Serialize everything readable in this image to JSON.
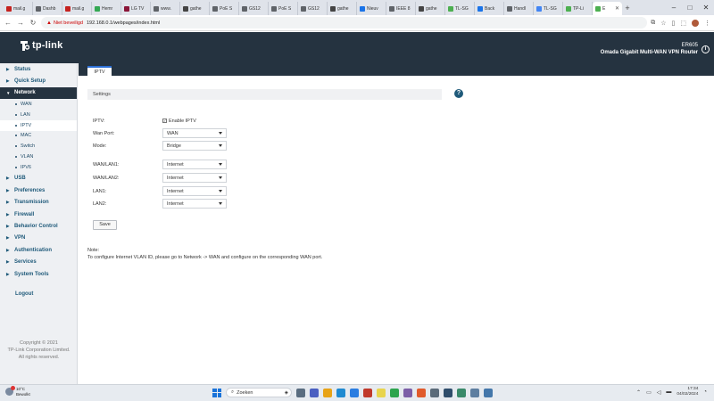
{
  "browser": {
    "tabs": [
      {
        "label": "mail.g",
        "color": "#c5221f"
      },
      {
        "label": "Dashb",
        "color": "#5f6368"
      },
      {
        "label": "mail.g",
        "color": "#c5221f"
      },
      {
        "label": "Hemr",
        "color": "#34a853"
      },
      {
        "label": "LG TV",
        "color": "#8a1538"
      },
      {
        "label": "www.",
        "color": "#5f6368"
      },
      {
        "label": "gathe",
        "color": "#444"
      },
      {
        "label": "PoE S",
        "color": "#5f6368"
      },
      {
        "label": "GS12",
        "color": "#5f6368"
      },
      {
        "label": "PoE S",
        "color": "#5f6368"
      },
      {
        "label": "GS12",
        "color": "#5f6368"
      },
      {
        "label": "gathe",
        "color": "#444"
      },
      {
        "label": "Nieuv",
        "color": "#1a73e8"
      },
      {
        "label": "IEEE 8",
        "color": "#5f6368"
      },
      {
        "label": "gathe",
        "color": "#444"
      },
      {
        "label": "TL-SG",
        "color": "#4caf50"
      },
      {
        "label": "Back",
        "color": "#1a73e8"
      },
      {
        "label": "Handl",
        "color": "#5f6368"
      },
      {
        "label": "TL-SG",
        "color": "#4285f4"
      },
      {
        "label": "TP-Li",
        "color": "#4caf50"
      },
      {
        "label": "E",
        "color": "#4caf50"
      }
    ],
    "insecure_label": "Niet beveiligd",
    "url": "192.168.0.1/webpages/index.html"
  },
  "header": {
    "logo_text": "tp-link",
    "model": "ER605",
    "model_desc": "Omada Gigabit Multi-WAN VPN Router"
  },
  "sidebar": {
    "items": [
      {
        "label": "Status"
      },
      {
        "label": "Quick Setup"
      },
      {
        "label": "Network"
      },
      {
        "label": "USB"
      },
      {
        "label": "Preferences"
      },
      {
        "label": "Transmission"
      },
      {
        "label": "Firewall"
      },
      {
        "label": "Behavior Control"
      },
      {
        "label": "VPN"
      },
      {
        "label": "Authentication"
      },
      {
        "label": "Services"
      },
      {
        "label": "System Tools"
      }
    ],
    "network_sub": [
      {
        "label": "WAN"
      },
      {
        "label": "LAN"
      },
      {
        "label": "IPTV"
      },
      {
        "label": "MAC"
      },
      {
        "label": "Switch"
      },
      {
        "label": "VLAN"
      },
      {
        "label": "IPV6"
      }
    ],
    "logout": "Logout",
    "copyright_1": "Copyright © 2021",
    "copyright_2": "TP-Link Corporation Limited.",
    "copyright_3": "All rights reserved."
  },
  "main": {
    "tab": "IPTV",
    "section": "Settings",
    "iptv_label": "IPTV:",
    "enable_label": "Enable IPTV",
    "enable_checked": true,
    "wan_port_label": "Wan Port:",
    "wan_port_value": "WAN",
    "mode_label": "Mode:",
    "mode_value": "Bridge",
    "wan_lan1_label": "WAN/LAN1:",
    "wan_lan1_value": "Internet",
    "wan_lan2_label": "WAN/LAN2:",
    "wan_lan2_value": "Internet",
    "lan1_label": "LAN1:",
    "lan1_value": "Internet",
    "lan2_label": "LAN2:",
    "lan2_value": "Internet",
    "save": "Save",
    "note_title": "Note:",
    "note_text": "To configure Internet VLAN ID, please go to Network -> WAN and configure on the corresponding WAN port."
  },
  "taskbar": {
    "temp": "10°C",
    "weather": "Bewolkt",
    "search": "Zoeken",
    "time": "17:34",
    "date": "04/02/2024"
  }
}
